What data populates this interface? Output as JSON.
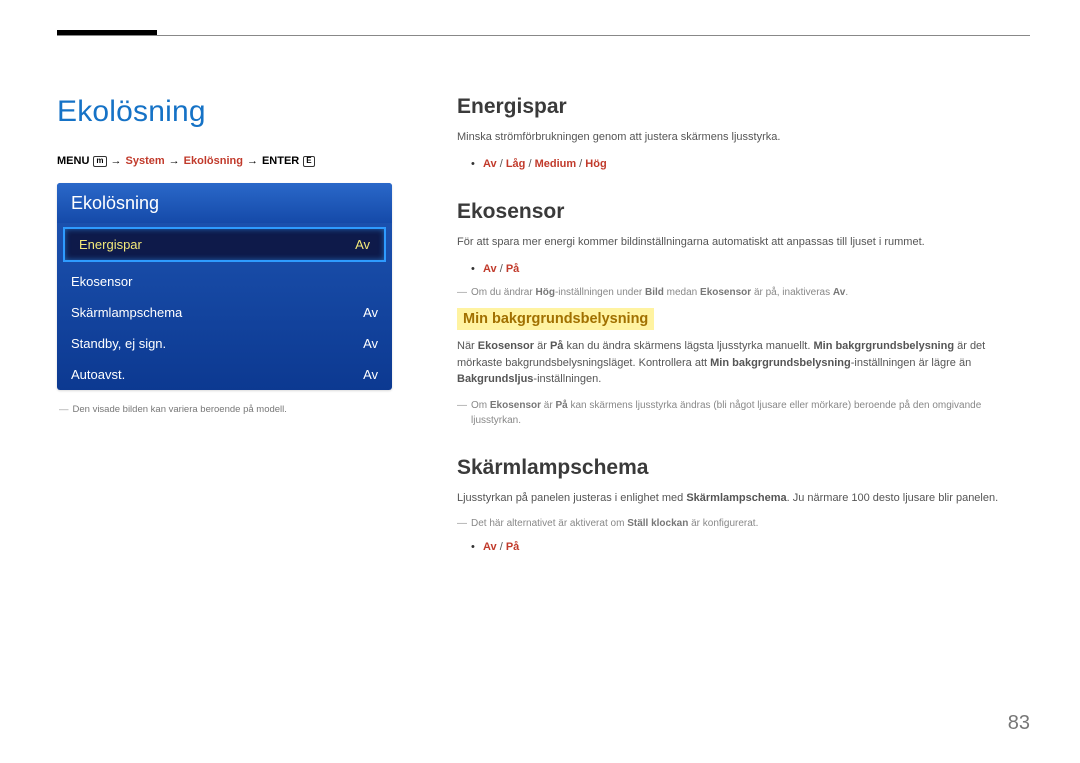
{
  "page_number": "83",
  "left": {
    "title": "Ekolösning",
    "breadcrumb": {
      "pre": "MENU",
      "menu_icon": "m",
      "arrow": "→",
      "p1": "System",
      "p2": "Ekolösning",
      "post": "ENTER",
      "enter_icon": "E"
    },
    "menu": {
      "title": "Ekolösning",
      "rows": [
        {
          "label": "Energispar",
          "value": "Av",
          "selected": true
        },
        {
          "label": "Ekosensor",
          "value": "",
          "selected": false
        },
        {
          "label": "Skärmlampschema",
          "value": "Av",
          "selected": false
        },
        {
          "label": "Standby, ej sign.",
          "value": "Av",
          "selected": false
        },
        {
          "label": "Autoavst.",
          "value": "Av",
          "selected": false
        }
      ]
    },
    "caption": "Den visade bilden kan variera beroende på modell."
  },
  "right": {
    "energispar": {
      "h": "Energispar",
      "p": "Minska strömförbrukningen genom att justera skärmens ljusstyrka.",
      "opts": [
        "Av",
        "Låg",
        "Medium",
        "Hög"
      ]
    },
    "ekosensor": {
      "h": "Ekosensor",
      "p": "För att spara mer energi kommer bildinställningarna automatiskt att anpassas till ljuset i rummet.",
      "opts": [
        "Av",
        "På"
      ],
      "note1_a": "Om du ändrar ",
      "note1_b": "Hög",
      "note1_c": "-inställningen under ",
      "note1_d": "Bild",
      "note1_e": " medan ",
      "note1_f": "Ekosensor",
      "note1_g": " är på, inaktiveras ",
      "note1_h": "Av",
      "note1_i": ".",
      "sub_h": "Min bakgrgrundsbelysning",
      "sub_p_a": "När ",
      "sub_p_b": "Ekosensor",
      "sub_p_c": " är ",
      "sub_p_d": "På",
      "sub_p_e": " kan du ändra skärmens lägsta ljusstyrka manuellt. ",
      "sub_p_f": "Min bakgrgrundsbelysning",
      "sub_p_g": " är det mörkaste bakgrundsbelysningsläget. Kontrollera att ",
      "sub_p_h": "Min bakgrgrundsbelysning",
      "sub_p_i": "-inställningen är lägre än ",
      "sub_p_j": "Bakgrundsljus",
      "sub_p_k": "-inställningen.",
      "note2_a": "Om ",
      "note2_b": "Ekosensor",
      "note2_c": " är ",
      "note2_d": "På",
      "note2_e": " kan skärmens ljusstyrka ändras (bli något ljusare eller mörkare) beroende på den omgivande ljusstyrkan."
    },
    "skarm": {
      "h": "Skärmlampschema",
      "p_a": "Ljusstyrkan på panelen justeras i enlighet med ",
      "p_b": "Skärmlampschema",
      "p_c": ". Ju närmare 100 desto ljusare blir panelen.",
      "note_a": "Det här alternativet är aktiverat om ",
      "note_b": "Ställ klockan",
      "note_c": " är konfigurerat.",
      "opts": [
        "Av",
        "På"
      ]
    }
  }
}
